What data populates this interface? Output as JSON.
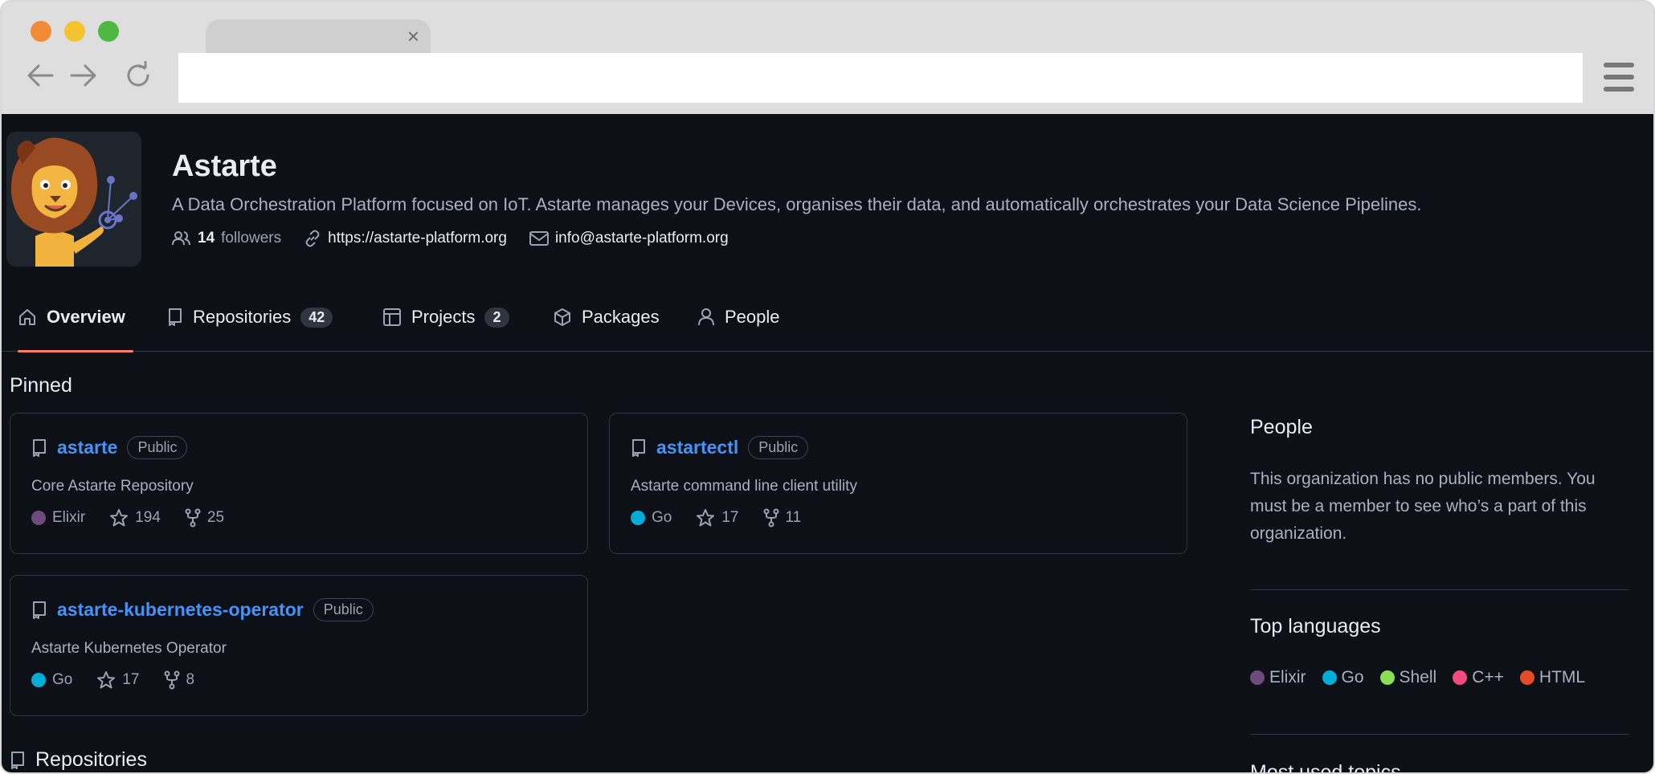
{
  "browser": {
    "tab_title": "",
    "tab_close": "×",
    "address": ""
  },
  "org": {
    "name": "Astarte",
    "description": "A Data Orchestration Platform focused on IoT. Astarte manages your Devices, organises their data, and automatically orchestrates your Data Science Pipelines.",
    "followers_count": "14",
    "followers_label": "followers",
    "website": "https://astarte-platform.org",
    "email": "info@astarte-platform.org"
  },
  "tabs": [
    {
      "label": "Overview",
      "icon": "home-icon",
      "active": true
    },
    {
      "label": "Repositories",
      "icon": "repo-icon",
      "count": "42"
    },
    {
      "label": "Projects",
      "icon": "table-icon",
      "count": "2"
    },
    {
      "label": "Packages",
      "icon": "package-icon"
    },
    {
      "label": "People",
      "icon": "person-icon"
    }
  ],
  "pinned": {
    "title": "Pinned",
    "repos": [
      {
        "name": "astarte",
        "visibility": "Public",
        "description": "Core Astarte Repository",
        "language": "Elixir",
        "language_color": "#6e4a7e",
        "stars": "194",
        "forks": "25"
      },
      {
        "name": "astartectl",
        "visibility": "Public",
        "description": "Astarte command line client utility",
        "language": "Go",
        "language_color": "#00add8",
        "stars": "17",
        "forks": "11"
      },
      {
        "name": "astarte-kubernetes-operator",
        "visibility": "Public",
        "description": "Astarte Kubernetes Operator",
        "language": "Go",
        "language_color": "#00add8",
        "stars": "17",
        "forks": "8"
      }
    ]
  },
  "repositories_heading": "Repositories",
  "sidebar": {
    "people_title": "People",
    "people_text": "This organization has no public members. You must be a member to see who’s a part of this organization.",
    "languages_title": "Top languages",
    "languages": [
      {
        "name": "Elixir",
        "color": "#6e4a7e"
      },
      {
        "name": "Go",
        "color": "#00add8"
      },
      {
        "name": "Shell",
        "color": "#89e051"
      },
      {
        "name": "C++",
        "color": "#f34b7d"
      },
      {
        "name": "HTML",
        "color": "#e34c26"
      }
    ],
    "topics_title": "Most used topics"
  }
}
